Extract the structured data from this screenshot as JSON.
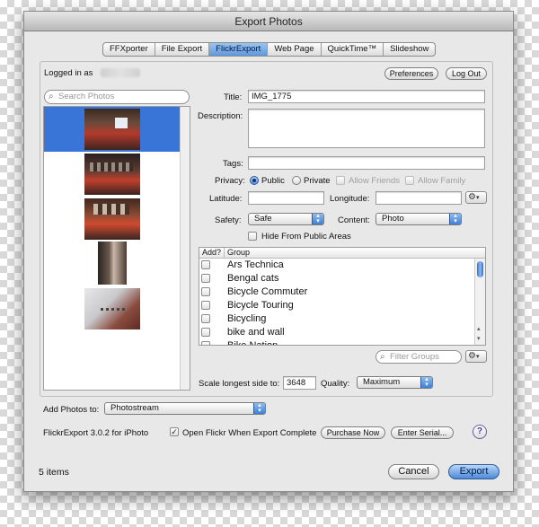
{
  "window": {
    "title": "Export Photos"
  },
  "tabs": [
    "FFXporter",
    "File Export",
    "FlickrExport",
    "Web Page",
    "QuickTime™",
    "Slideshow"
  ],
  "active_tab_index": 2,
  "account": {
    "logged_in_label": "Logged in as",
    "preferences_label": "Preferences",
    "logout_label": "Log Out"
  },
  "photos": {
    "search_placeholder": "Search Photos",
    "selected_index": 0
  },
  "form": {
    "title_label": "Title:",
    "title_value": "IMG_1775",
    "description_label": "Description:",
    "description_value": "",
    "tags_label": "Tags:",
    "tags_value": "",
    "privacy_label": "Privacy:",
    "public_label": "Public",
    "private_label": "Private",
    "allow_friends_label": "Allow Friends",
    "allow_family_label": "Allow Family",
    "privacy_selected": "Public",
    "latitude_label": "Latitude:",
    "latitude_value": "",
    "longitude_label": "Longitude:",
    "longitude_value": "",
    "safety_label": "Safety:",
    "safety_value": "Safe",
    "content_label": "Content:",
    "content_value": "Photo",
    "hide_label": "Hide From Public Areas",
    "hide_checked": false
  },
  "groups": {
    "col_add": "Add?",
    "col_group": "Group",
    "items": [
      "Ars Technica",
      "Bengal cats",
      "Bicycle Commuter",
      "Bicycle Touring",
      "Bicycling",
      "bike and wall",
      "Bike Nation"
    ],
    "filter_placeholder": "Filter Groups"
  },
  "scale": {
    "label": "Scale longest side to:",
    "value": "3648",
    "quality_label": "Quality:",
    "quality_value": "Maximum"
  },
  "add_photos": {
    "label": "Add Photos to:",
    "value": "Photostream"
  },
  "footer": {
    "version": "FlickrExport 3.0.2 for iPhoto",
    "open_flickr_label": "Open Flickr When Export Complete",
    "open_flickr_checked": true,
    "purchase_label": "Purchase Now",
    "serial_label": "Enter Serial...",
    "help_label": "?"
  },
  "bottom": {
    "items_count": "5 items",
    "cancel_label": "Cancel",
    "export_label": "Export"
  },
  "icons": {
    "search": "magnifier-icon",
    "gear": "gear-icon",
    "help": "help-icon"
  },
  "colors": {
    "accent": "#3875d7",
    "window_bg": "#e9e9e9"
  }
}
